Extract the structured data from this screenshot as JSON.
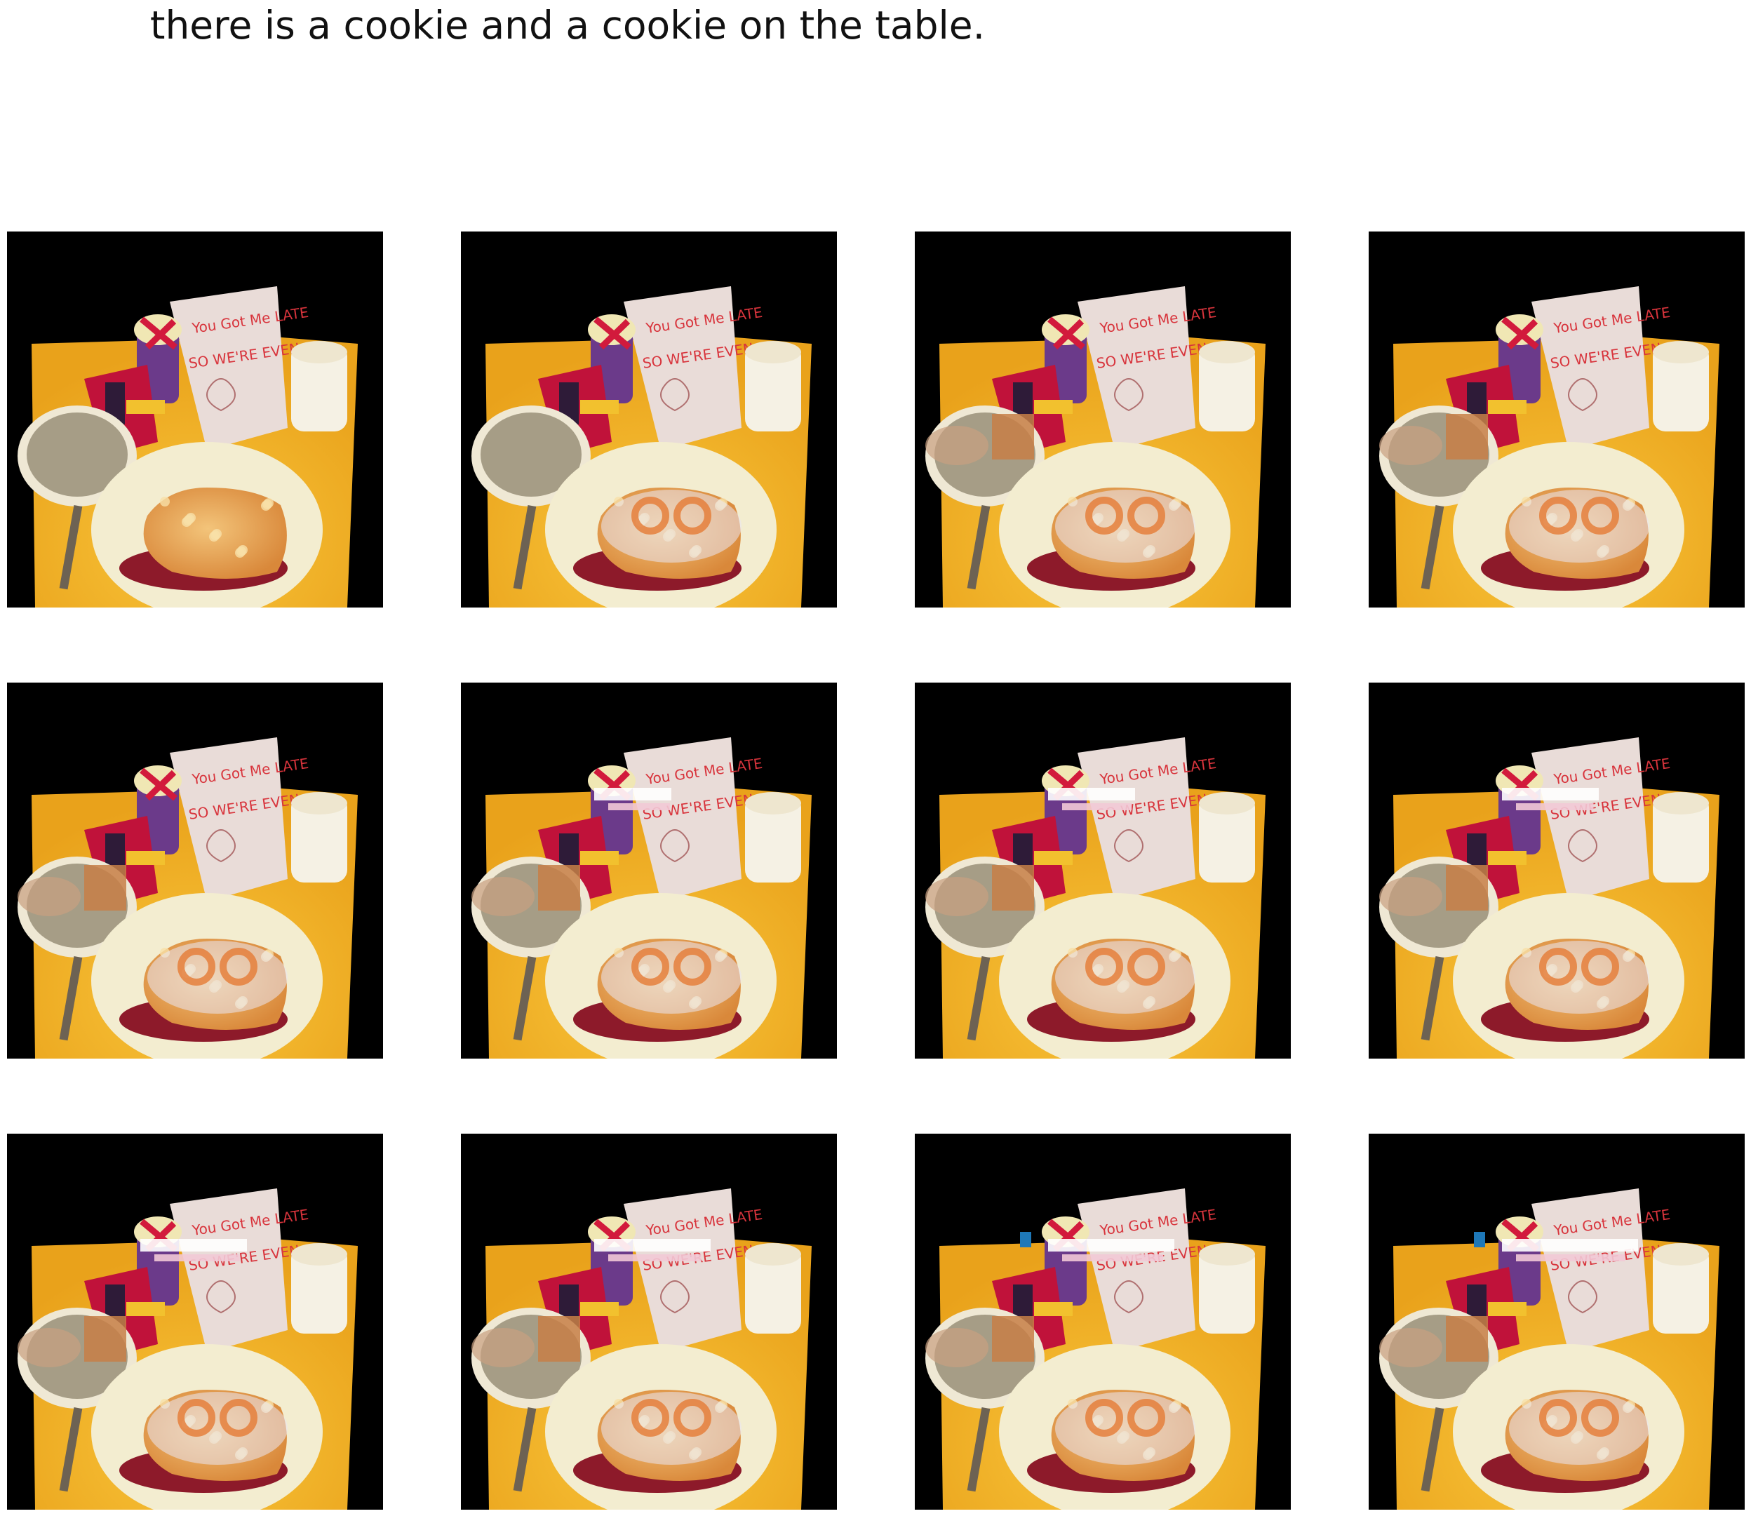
{
  "caption": "there is a cookie and a cookie on the table.",
  "grid": {
    "rows": 3,
    "cols": 4
  },
  "panels": [
    {
      "edit_level": 0
    },
    {
      "edit_level": 1
    },
    {
      "edit_level": 2
    },
    {
      "edit_level": 3
    },
    {
      "edit_level": 4
    },
    {
      "edit_level": 5
    },
    {
      "edit_level": 6
    },
    {
      "edit_level": 7
    },
    {
      "edit_level": 8
    },
    {
      "edit_level": 9
    },
    {
      "edit_level": 10
    },
    {
      "edit_level": 11
    }
  ],
  "colors": {
    "background": "#000000",
    "table": "#e9a21b",
    "plate": "#f3edd0",
    "card": "#e9dcd8",
    "card_text": "#d8343c",
    "box": "#c0123a",
    "cookie": "#d9883a",
    "sauce": "#8d1a2a",
    "soup": "#a69d86"
  },
  "card_lines": [
    "You Got Me LATE",
    "SO WE'RE EVEN"
  ]
}
